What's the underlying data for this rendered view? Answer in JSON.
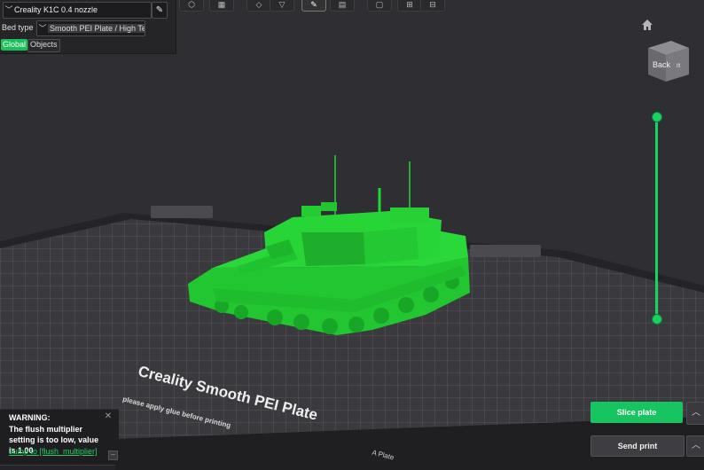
{
  "printer": {
    "name": "Creality K1C 0.4 nozzle",
    "edit_icon": "pencil-icon",
    "bed_type_label": "Bed type",
    "bed_type_value": "Smooth PEI Plate / High Te"
  },
  "tabs": {
    "global": "Global",
    "objects": "Objects"
  },
  "toolbar": {
    "icons": [
      "open-icon",
      "add-icon",
      "cube-icon",
      "arrange-icon",
      "orient-icon",
      "auto-arrange-icon",
      "split-icon",
      "layer-icon",
      "support-paint-icon",
      "seam-icon"
    ]
  },
  "viewport": {
    "view_cube_label": "Back",
    "plate_text": "Creality Smooth PEI Plate",
    "plate_text_small": "please apply glue before printing",
    "plate_corner_text": "A Plate",
    "model_color": "#22d633",
    "bed_color": "#3a3a3e"
  },
  "warning": {
    "title": "WARNING:",
    "message": "The flush multiplier setting is too low, value is 1.00",
    "link": "Jump to [flush_multiplier]"
  },
  "actions": {
    "slice": "Slice plate",
    "send_print": "Send print",
    "accent": "#16c55f"
  }
}
